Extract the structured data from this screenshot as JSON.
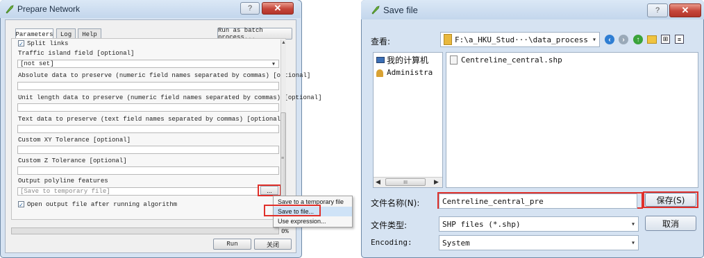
{
  "left_dialog": {
    "title": "Prepare Network",
    "help_label": "?",
    "close_label": "✕",
    "tabs": [
      "Parameters",
      "Log",
      "Help"
    ],
    "batch_button": "Run as batch process...",
    "split_links_label": "Split links",
    "traffic_island_label": "Traffic island field [optional]",
    "traffic_island_value": "[not set]",
    "absolute_label": "Absolute data to preserve (numeric field names separated by commas) [optional]",
    "unit_length_label": "Unit length data to preserve (numeric field names separated by commas) [optional]",
    "text_data_label": "Text data to preserve (text field names separated by commas) [optional]",
    "xy_tolerance_label": "Custom XY Tolerance [optional]",
    "z_tolerance_label": "Custom Z Tolerance [optional]",
    "output_label": "Output polyline features",
    "output_placeholder": "[Save to temporary file]",
    "dots_label": "...",
    "open_output_label": "Open output file after running algorithm",
    "progress_percent": "0%",
    "progress_value": 0,
    "run_label": "Run",
    "close_button_label": "关闭"
  },
  "context_menu": {
    "items": [
      "Save to a temporary file",
      "Save to file...",
      "Use expression..."
    ],
    "highlighted_index": 1
  },
  "right_dialog": {
    "title": "Save file",
    "help_label": "?",
    "close_label": "✕",
    "look_in_label": "查看:",
    "path_value": "F:\\a_HKU_Stud···\\data_process",
    "sidebar_items": [
      "我的计算机",
      "Administra"
    ],
    "files": [
      "Centreline_central.shp"
    ],
    "scroll_mark": "III",
    "filename_label": "文件名称(N):",
    "filename_value": "Centreline_central_pre",
    "save_button": "保存(S)",
    "filetype_label": "文件类型:",
    "filetype_value": "SHP files (*.shp)",
    "cancel_button": "取消",
    "encoding_label": "Encoding:",
    "encoding_value": "System"
  },
  "colors": {
    "window_frame": "#d6e3f2",
    "highlight_red": "#e0302a",
    "close_red": "#c5453a"
  }
}
